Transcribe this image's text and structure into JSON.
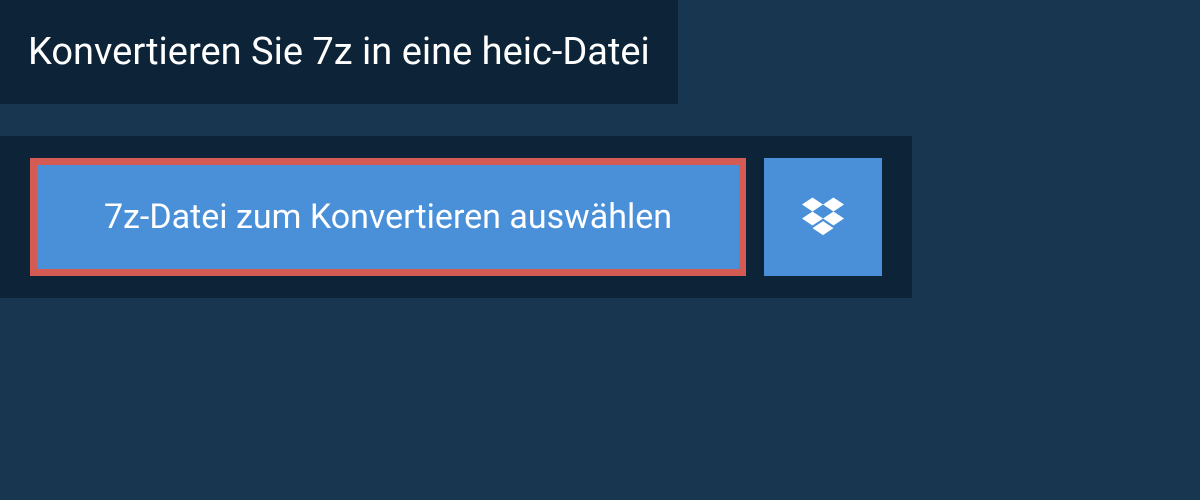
{
  "header": {
    "title": "Konvertieren Sie 7z in eine heic-Datei"
  },
  "actions": {
    "select_file_label": "7z-Datei zum Konvertieren auswählen",
    "dropbox_icon": "dropbox-icon"
  },
  "colors": {
    "page_bg": "#193650",
    "panel_bg": "#0d2438",
    "button_bg": "#4a90d9",
    "highlight_border": "#d45a54",
    "text": "#ffffff"
  }
}
